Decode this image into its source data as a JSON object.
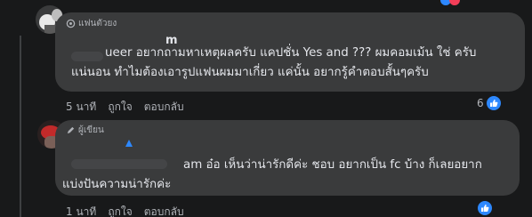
{
  "comments": [
    {
      "badge": "แฟนตัวยง",
      "badge_icon": "medal-icon",
      "author": "m",
      "lines": [
        "ueer อยากถามหาเหตุผลครับ แคปชั่น Yes and ??? ผมคอมเม้น ใช่ ครับ",
        "แน่นอน ทำไมต้องเอารูปแฟนผมมาเกี่ยว แค่นั้น อยากรู้คำตอบสั้นๆครับ"
      ],
      "time": "5 นาที",
      "like_label": "ถูกใจ",
      "reply_label": "ตอบกลับ",
      "reaction_count": "6",
      "reaction_icon": "like-icon"
    },
    {
      "badge": "ผู้เขียน",
      "badge_icon": "pencil-icon",
      "author": "",
      "lines": [
        "am อ๋อ เห็นว่าน่ารักดีค่ะ ชอบ อยากเป็น fc บ้าง ก็เลยอยาก",
        "แบ่งปันความน่ารักค่ะ"
      ],
      "time": "1 นาที",
      "like_label": "ถูกใจ",
      "reply_label": "ตอบกลับ",
      "reaction_count": "",
      "reaction_icon": "like-icon"
    }
  ],
  "colors": {
    "background": "#18191a",
    "bubble": "#3a3b3c",
    "text": "#e4e6eb",
    "secondary_text": "#b0b3b8",
    "like_blue": "#2d88ff"
  }
}
